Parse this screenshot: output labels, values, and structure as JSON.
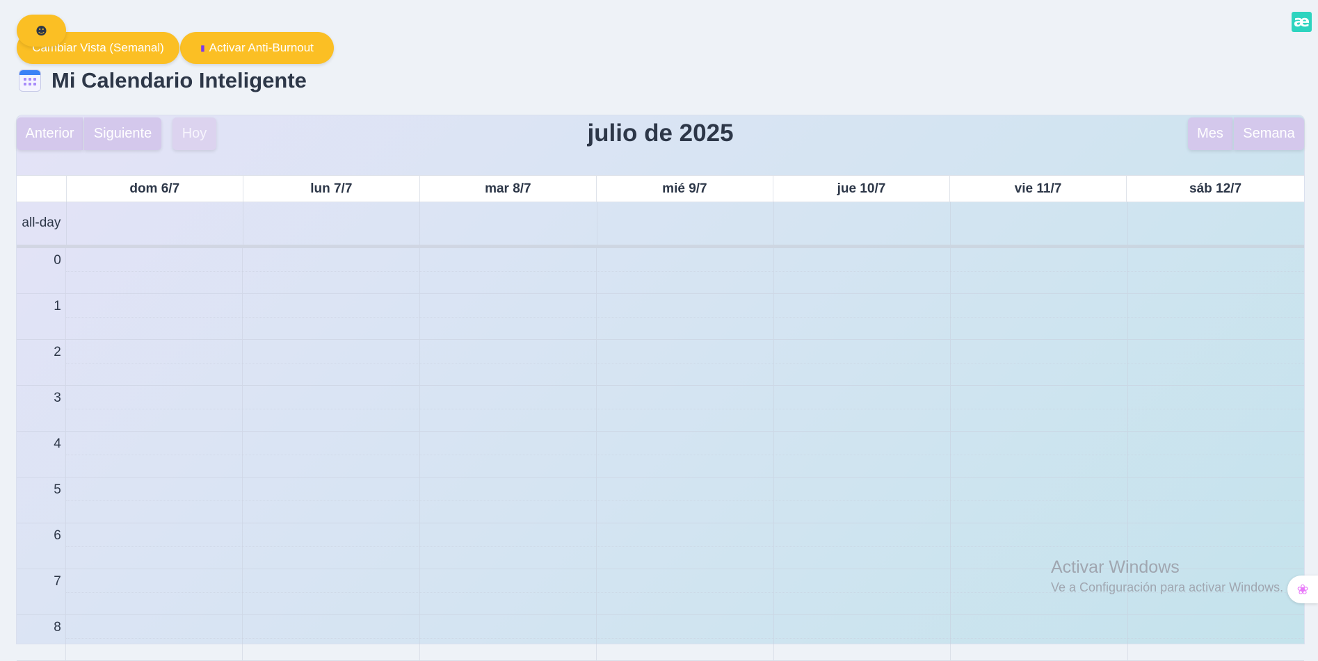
{
  "header": {
    "float_button_icon": "robot-icon",
    "float_button_glyph": "☻",
    "view_button_label": "Cambiar Vista (Semanal)",
    "burnout_button_label": "Activar Anti-Burnout",
    "burnout_icon_glyph": "▮",
    "extension_glyph": "æ",
    "title": "Mi Calendario Inteligente"
  },
  "calendar": {
    "toolbar": {
      "prev_label": "Anterior",
      "next_label": "Siguiente",
      "today_label": "Hoy",
      "month_label": "Mes",
      "week_label": "Semana"
    },
    "title": "julio de 2025",
    "days": [
      "dom 6/7",
      "lun 7/7",
      "mar 8/7",
      "mié 9/7",
      "jue 10/7",
      "vie 11/7",
      "sáb 12/7"
    ],
    "allday_label": "all-day",
    "hours": [
      "0",
      "1",
      "2",
      "3",
      "4",
      "5",
      "6",
      "7",
      "8"
    ]
  },
  "watermark": {
    "title": "Activar Windows",
    "subtitle": "Ve a Configuración para activar Windows."
  },
  "brain_button_glyph": "❀",
  "colors": {
    "accent_yellow": "#fbbf24",
    "toolbar_purple": "#d4c8ec",
    "extension_teal": "#2dd4bf"
  }
}
